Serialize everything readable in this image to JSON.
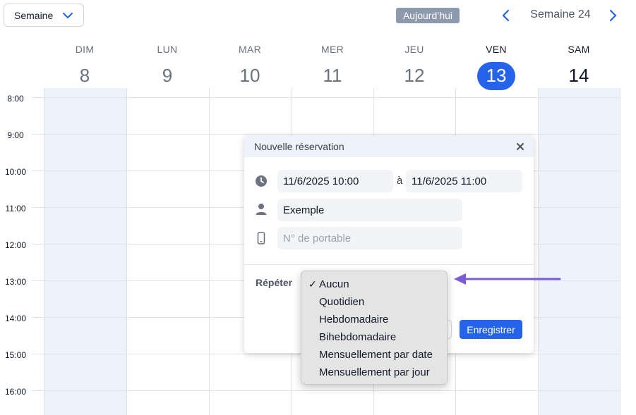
{
  "toolbar": {
    "view_select": "Semaine",
    "today_label": "Aujourd’hui",
    "week_label": "Semaine 24"
  },
  "days": [
    {
      "name": "DIM",
      "num": "8"
    },
    {
      "name": "LUN",
      "num": "9"
    },
    {
      "name": "MAR",
      "num": "10"
    },
    {
      "name": "MER",
      "num": "11"
    },
    {
      "name": "JEU",
      "num": "12"
    },
    {
      "name": "VEN",
      "num": "13"
    },
    {
      "name": "SAM",
      "num": "14"
    }
  ],
  "hours": [
    "8:00",
    "9:00",
    "10:00",
    "11:00",
    "12:00",
    "13:00",
    "14:00",
    "15:00",
    "16:00"
  ],
  "dialog": {
    "title": "Nouvelle réservation",
    "start": "11/6/2025  10:00",
    "separator": "à",
    "end": "11/6/2025  11:00",
    "name_value": "Exemple",
    "phone_placeholder": "N° de portable",
    "repeat_label": "Répéter",
    "save_label": "Enregistrer"
  },
  "repeat_options": [
    {
      "label": "Aucun",
      "selected": true
    },
    {
      "label": "Quotidien",
      "selected": false
    },
    {
      "label": "Hebdomadaire",
      "selected": false
    },
    {
      "label": "Bihebdomadaire",
      "selected": false
    },
    {
      "label": "Mensuellement par date",
      "selected": false
    },
    {
      "label": "Mensuellement par jour",
      "selected": false
    }
  ],
  "colors": {
    "accent": "#2563eb",
    "weekend_bg": "#eef2fb",
    "annotation_arrow": "#7c5cd6"
  }
}
